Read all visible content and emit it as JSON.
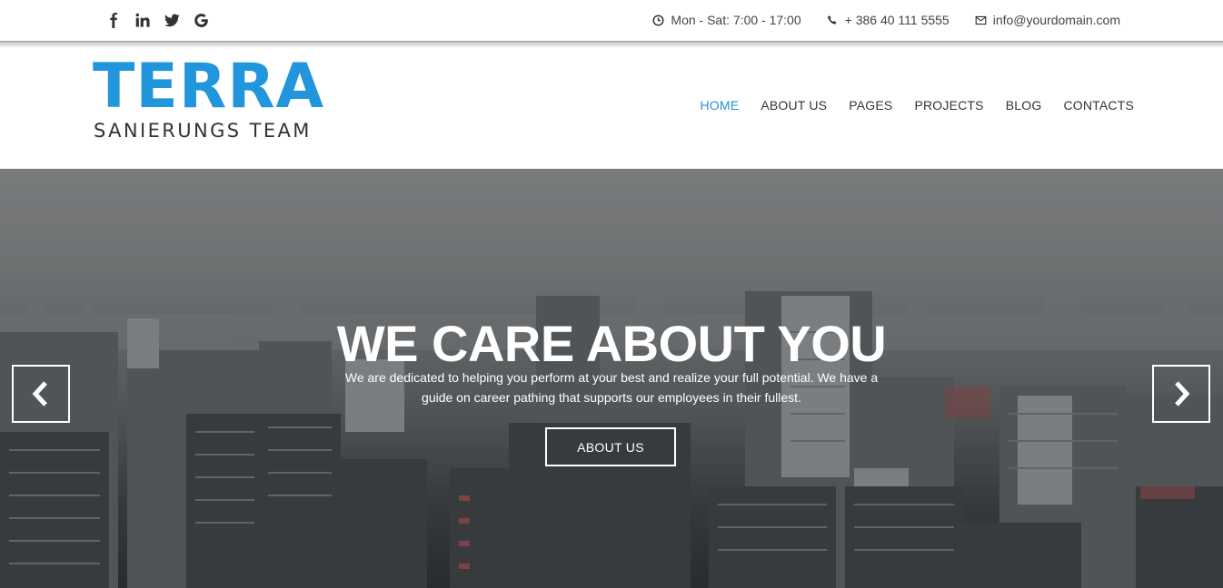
{
  "topbar": {
    "social": [
      {
        "icon": "facebook-icon"
      },
      {
        "icon": "linkedin-icon"
      },
      {
        "icon": "twitter-icon"
      },
      {
        "icon": "google-icon"
      }
    ],
    "hours": "Mon - Sat: 7:00 - 17:00",
    "phone": "+ 386 40 111 5555",
    "email": "info@yourdomain.com"
  },
  "logo": {
    "main": "TERRA",
    "sub": "SANIERUNGS TEAM"
  },
  "nav": {
    "items": [
      {
        "label": "HOME",
        "active": true
      },
      {
        "label": "ABOUT US"
      },
      {
        "label": "PAGES"
      },
      {
        "label": "PROJECTS"
      },
      {
        "label": "BLOG"
      },
      {
        "label": "CONTACTS"
      }
    ]
  },
  "hero": {
    "title": "WE CARE ABOUT YOU",
    "text_line1": "We are dedicated to helping you perform at your best and realize your full potential. We have a",
    "text_line2": "guide on career pathing that supports our employees in their fullest.",
    "button": "ABOUT US"
  },
  "colors": {
    "accent": "#2196dc",
    "nav_active": "#2a8fd8",
    "text": "#333333"
  }
}
